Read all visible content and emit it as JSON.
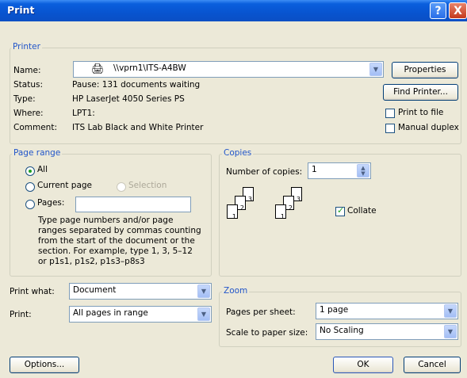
{
  "window": {
    "title": "Print",
    "help_glyph": "?",
    "close_glyph": "X"
  },
  "printer": {
    "legend": "Printer",
    "name_label": "Name:",
    "name_value": "\\\\vprn1\\ITS-A4BW",
    "status_label": "Status:",
    "status_value": "Pause: 131 documents waiting",
    "type_label": "Type:",
    "type_value": "HP LaserJet 4050 Series PS",
    "where_label": "Where:",
    "where_value": "LPT1:",
    "comment_label": "Comment:",
    "comment_value": "ITS Lab Black and White Printer",
    "properties_label": "Properties",
    "find_printer_label": "Find Printer...",
    "print_to_file_label": "Print to file",
    "manual_duplex_label": "Manual duplex"
  },
  "page_range": {
    "legend": "Page range",
    "all_label": "All",
    "current_label": "Current page",
    "selection_label": "Selection",
    "pages_label": "Pages:",
    "pages_value": "",
    "help_text": "Type page numbers and/or page ranges separated by commas counting from the start of the document or the section. For example, type 1, 3, 5–12 or p1s1, p1s2, p1s3–p8s3",
    "selected": "all"
  },
  "copies": {
    "legend": "Copies",
    "number_label": "Number of copies:",
    "number_value": "1",
    "collate_label": "Collate",
    "collate_checked": true
  },
  "print_what": {
    "label": "Print what:",
    "value": "Document"
  },
  "print": {
    "label": "Print:",
    "value": "All pages in range"
  },
  "zoom": {
    "legend": "Zoom",
    "pages_per_sheet_label": "Pages per sheet:",
    "pages_per_sheet_value": "1 page",
    "scale_label": "Scale to paper size:",
    "scale_value": "No Scaling"
  },
  "footer": {
    "options_label": "Options...",
    "ok_label": "OK",
    "cancel_label": "Cancel"
  }
}
